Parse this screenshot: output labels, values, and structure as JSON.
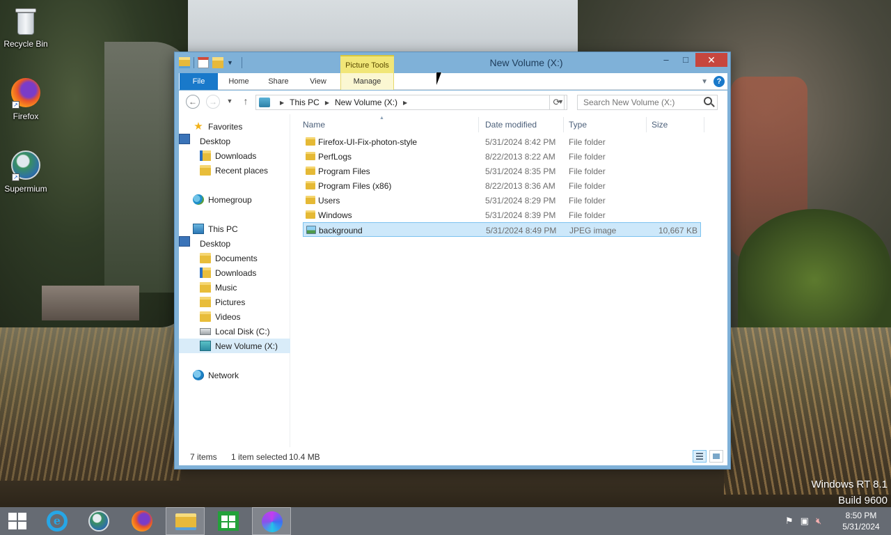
{
  "desktop": {
    "icons": [
      {
        "label": "Recycle Bin"
      },
      {
        "label": "Firefox"
      },
      {
        "label": "Supermium"
      }
    ]
  },
  "window": {
    "title": "New Volume (X:)",
    "context_tab_group": "Picture Tools",
    "ribbon_tabs": {
      "file": "File",
      "home": "Home",
      "share": "Share",
      "view": "View",
      "manage": "Manage"
    },
    "help": "?",
    "controls": {
      "minimize": "–",
      "maximize": "□",
      "close": "✕"
    }
  },
  "address_bar": {
    "crumbs": [
      "This PC",
      "New Volume (X:)"
    ],
    "search_placeholder": "Search New Volume (X:)"
  },
  "nav_pane": {
    "favorites": {
      "label": "Favorites",
      "items": [
        "Desktop",
        "Downloads",
        "Recent places"
      ]
    },
    "homegroup": "Homegroup",
    "this_pc": {
      "label": "This PC",
      "items": [
        "Desktop",
        "Documents",
        "Downloads",
        "Music",
        "Pictures",
        "Videos",
        "Local Disk (C:)",
        "New Volume (X:)"
      ]
    },
    "network": "Network"
  },
  "file_list": {
    "columns": {
      "name": "Name",
      "date": "Date modified",
      "type": "Type",
      "size": "Size"
    },
    "rows": [
      {
        "name": "Firefox-UI-Fix-photon-style",
        "date": "5/31/2024 8:42 PM",
        "type": "File folder",
        "size": ""
      },
      {
        "name": "PerfLogs",
        "date": "8/22/2013 8:22 AM",
        "type": "File folder",
        "size": ""
      },
      {
        "name": "Program Files",
        "date": "5/31/2024 8:35 PM",
        "type": "File folder",
        "size": ""
      },
      {
        "name": "Program Files (x86)",
        "date": "8/22/2013 8:36 AM",
        "type": "File folder",
        "size": ""
      },
      {
        "name": "Users",
        "date": "5/31/2024 8:29 PM",
        "type": "File folder",
        "size": ""
      },
      {
        "name": "Windows",
        "date": "5/31/2024 8:39 PM",
        "type": "File folder",
        "size": ""
      },
      {
        "name": "background",
        "date": "5/31/2024 8:49 PM",
        "type": "JPEG image",
        "size": "10,667 KB"
      }
    ]
  },
  "status_bar": {
    "item_count": "7 items",
    "selection": "1 item selected",
    "selection_size": "10.4 MB"
  },
  "watermark": {
    "line1": "Windows RT 8.1",
    "line2": "Build 9600"
  },
  "taskbar": {
    "clock_time": "8:50 PM",
    "clock_date": "5/31/2024",
    "ie_glyph": "e"
  },
  "colors": {
    "accent": "#1979ca",
    "close_button": "#c7463e",
    "picture_tools": "#f1e678",
    "selection": "#cde8fa"
  }
}
